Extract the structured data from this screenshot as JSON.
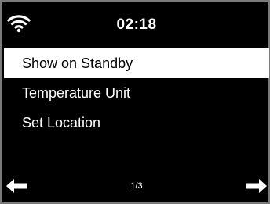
{
  "status_bar": {
    "signal_icon": "wifi-icon",
    "time": "02:18"
  },
  "menu": {
    "items": [
      {
        "label": "Show on Standby",
        "selected": true
      },
      {
        "label": "Temperature Unit",
        "selected": false
      },
      {
        "label": "Set Location",
        "selected": false
      }
    ]
  },
  "footer": {
    "left_icon": "arrow-left-icon",
    "page": "1/3",
    "right_icon": "arrow-right-icon"
  },
  "colors": {
    "background": "#000000",
    "text": "#ffffff",
    "highlight_background": "#ffffff",
    "highlight_text": "#000000"
  }
}
